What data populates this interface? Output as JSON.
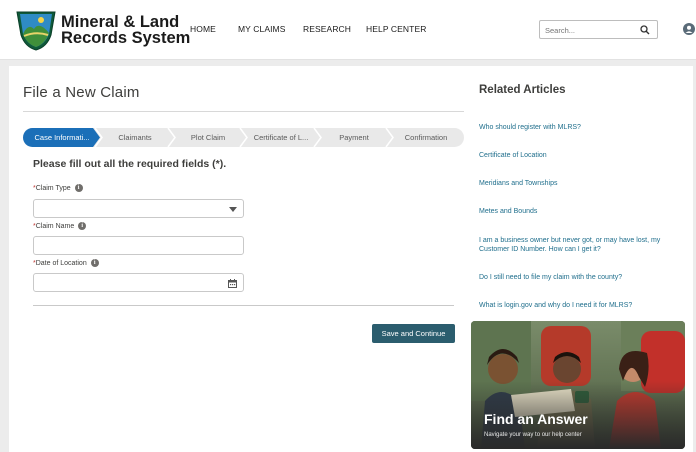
{
  "header": {
    "brand_line1": "Mineral & Land",
    "brand_line2": "Records System",
    "nav": [
      "HOME",
      "MY CLAIMS",
      "RESEARCH",
      "HELP CENTER"
    ],
    "search_placeholder": "Search..."
  },
  "form": {
    "title": "File a New Claim",
    "steps": [
      "Case Informati...",
      "Claimants",
      "Plot Claim",
      "Certificate of L...",
      "Payment",
      "Confirmation"
    ],
    "active_step": 0,
    "required_note": "Please fill out all the required fields (*).",
    "fields": [
      {
        "label": "Claim Type",
        "type": "select",
        "value": ""
      },
      {
        "label": "Claim Name",
        "type": "text",
        "value": ""
      },
      {
        "label": "Date of Location",
        "type": "date",
        "value": ""
      }
    ],
    "required_marker": "*",
    "save_label": "Save and Continue"
  },
  "related": {
    "title": "Related Articles",
    "articles": [
      "Who should register with MLRS?",
      "Certificate of Location",
      "Meridians and Townships",
      "Metes and Bounds",
      "I am a business owner but never got, or may have lost, my Customer ID Number. How can I get it?",
      "Do I still need to file my claim with the county?",
      "What is login.gov and why do I need it for MLRS?"
    ]
  },
  "help_card": {
    "title": "Find an Answer",
    "subtitle": "Navigate your way to our help center"
  },
  "colors": {
    "accent": "#1b6fb8",
    "button": "#2b5d6e",
    "link": "#1f6e8c",
    "step_inactive": "#e9e9e9"
  }
}
